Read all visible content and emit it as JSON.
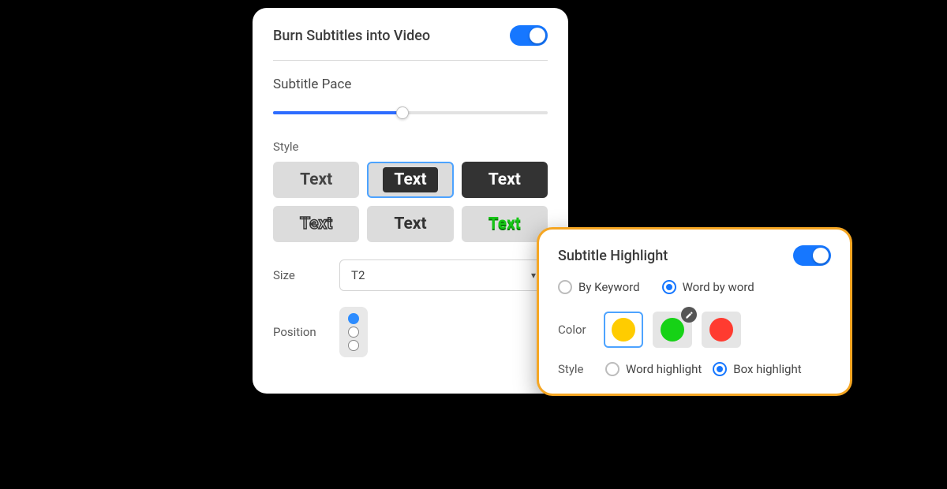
{
  "panel": {
    "burn_label": "Burn Subtitles into Video",
    "burn_on": true,
    "pace_label": "Subtitle Pace",
    "pace_value": 47,
    "style_label": "Style",
    "style_tiles": [
      "Text",
      "Text",
      "Text",
      "Text",
      "Text",
      "Text"
    ],
    "style_selected_index": 1,
    "size_label": "Size",
    "size_value": "T2",
    "position_label": "Position",
    "position_selected": 0
  },
  "highlight": {
    "title": "Subtitle Highlight",
    "enabled": true,
    "mode_options": [
      "By Keyword",
      "Word by word"
    ],
    "mode_selected": 1,
    "color_label": "Color",
    "colors": [
      "#ffcc00",
      "#16d216",
      "#ff3b30"
    ],
    "color_selected": 0,
    "style_label": "Style",
    "style_options": [
      "Word highlight",
      "Box highlight"
    ],
    "style_selected": 1
  }
}
